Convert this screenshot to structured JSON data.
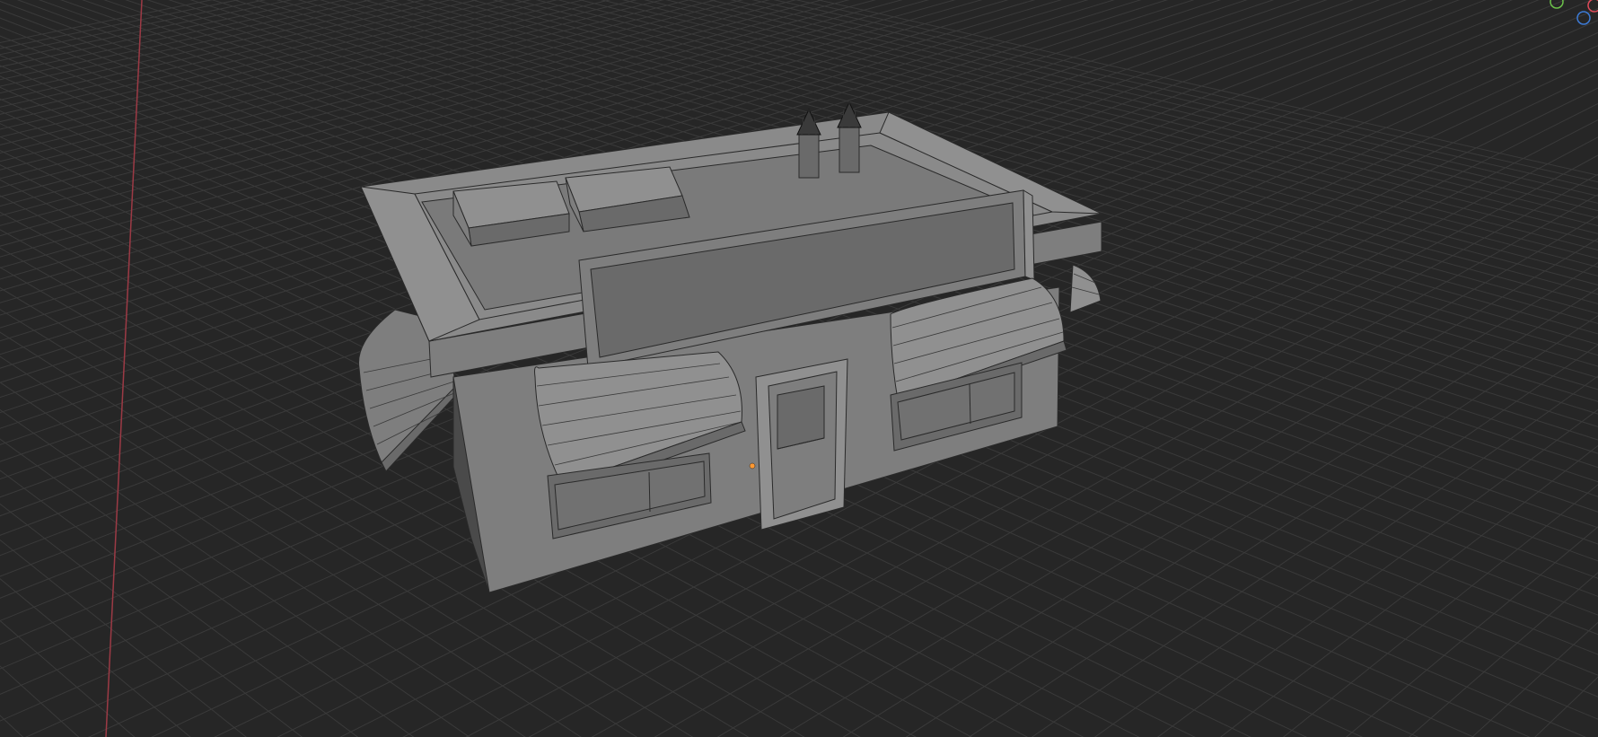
{
  "app": {
    "view": "3D Viewport",
    "shading": "solid"
  },
  "colors": {
    "background": "#262626",
    "grid": "#3a3a3a",
    "x_axis": "#9c3a45",
    "origin": "#ff9933",
    "gizmo_y": "#6cc24a",
    "gizmo_z": "#3d7bd6",
    "gizmo_x": "#e04b5a"
  },
  "scene": {
    "object": "building",
    "parts": [
      "roof-parapet",
      "roof-vent",
      "roof-vent",
      "chimney-vent",
      "chimney-vent",
      "sign-board",
      "front-door",
      "window",
      "window",
      "awning",
      "awning",
      "awning",
      "awning"
    ]
  },
  "gizmo": {
    "axes": [
      "x-axis-icon",
      "y-axis-icon",
      "z-axis-icon"
    ]
  }
}
